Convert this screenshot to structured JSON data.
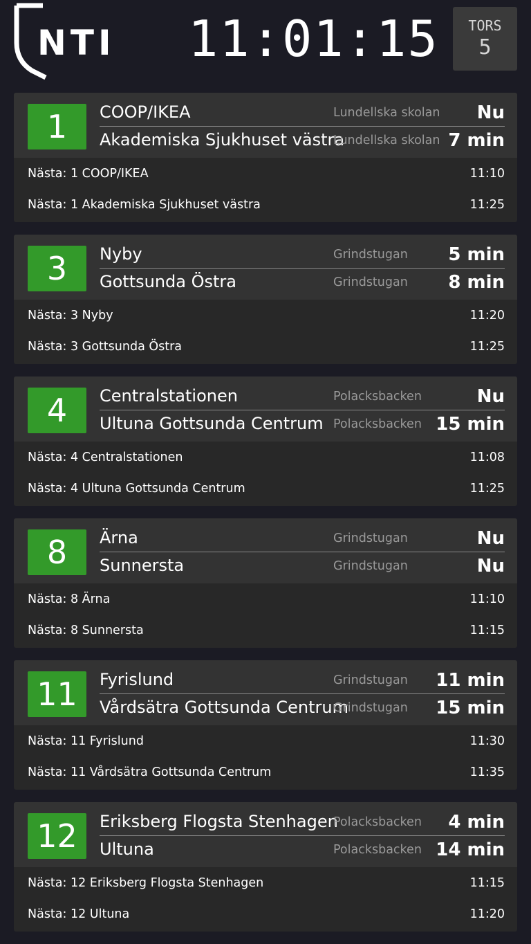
{
  "header": {
    "logo_text": "NTI",
    "clock": "11:01:15",
    "day_name": "TORS",
    "day_number": "5"
  },
  "colors": {
    "background": "#1b1b24",
    "card": "#282828",
    "card_header": "#333333",
    "line_badge": "#339a2a",
    "stop_text": "#9a9a9a"
  },
  "lines": [
    {
      "line": "1",
      "departures": [
        {
          "destination": "COOP/IKEA",
          "stop": "Lundellska skolan",
          "eta": "Nu"
        },
        {
          "destination": "Akademiska Sjukhuset västra",
          "stop": "Lundellska skolan",
          "eta": "7 min"
        }
      ],
      "next": [
        {
          "text": "Nästa: 1 COOP/IKEA",
          "time": "11:10"
        },
        {
          "text": "Nästa: 1 Akademiska Sjukhuset västra",
          "time": "11:25"
        }
      ]
    },
    {
      "line": "3",
      "departures": [
        {
          "destination": "Nyby",
          "stop": "Grindstugan",
          "eta": "5 min"
        },
        {
          "destination": "Gottsunda Östra",
          "stop": "Grindstugan",
          "eta": "8 min"
        }
      ],
      "next": [
        {
          "text": "Nästa: 3 Nyby",
          "time": "11:20"
        },
        {
          "text": "Nästa: 3 Gottsunda Östra",
          "time": "11:25"
        }
      ]
    },
    {
      "line": "4",
      "departures": [
        {
          "destination": "Centralstationen",
          "stop": "Polacksbacken",
          "eta": "Nu"
        },
        {
          "destination": "Ultuna Gottsunda Centrum",
          "stop": "Polacksbacken",
          "eta": "15 min"
        }
      ],
      "next": [
        {
          "text": "Nästa: 4 Centralstationen",
          "time": "11:08"
        },
        {
          "text": "Nästa: 4 Ultuna Gottsunda Centrum",
          "time": "11:25"
        }
      ]
    },
    {
      "line": "8",
      "departures": [
        {
          "destination": "Ärna",
          "stop": "Grindstugan",
          "eta": "Nu"
        },
        {
          "destination": "Sunnersta",
          "stop": "Grindstugan",
          "eta": "Nu"
        }
      ],
      "next": [
        {
          "text": "Nästa: 8 Ärna",
          "time": "11:10"
        },
        {
          "text": "Nästa: 8 Sunnersta",
          "time": "11:15"
        }
      ]
    },
    {
      "line": "11",
      "departures": [
        {
          "destination": "Fyrislund",
          "stop": "Grindstugan",
          "eta": "11 min"
        },
        {
          "destination": "Vårdsätra Gottsunda Centrum",
          "stop": "Grindstugan",
          "eta": "15 min"
        }
      ],
      "next": [
        {
          "text": "Nästa: 11 Fyrislund",
          "time": "11:30"
        },
        {
          "text": "Nästa: 11 Vårdsätra Gottsunda Centrum",
          "time": "11:35"
        }
      ]
    },
    {
      "line": "12",
      "departures": [
        {
          "destination": "Eriksberg Flogsta Stenhagen",
          "stop": "Polacksbacken",
          "eta": "4 min"
        },
        {
          "destination": "Ultuna",
          "stop": "Polacksbacken",
          "eta": "14 min"
        }
      ],
      "next": [
        {
          "text": "Nästa: 12 Eriksberg Flogsta Stenhagen",
          "time": "11:15"
        },
        {
          "text": "Nästa: 12 Ultuna",
          "time": "11:20"
        }
      ]
    }
  ]
}
